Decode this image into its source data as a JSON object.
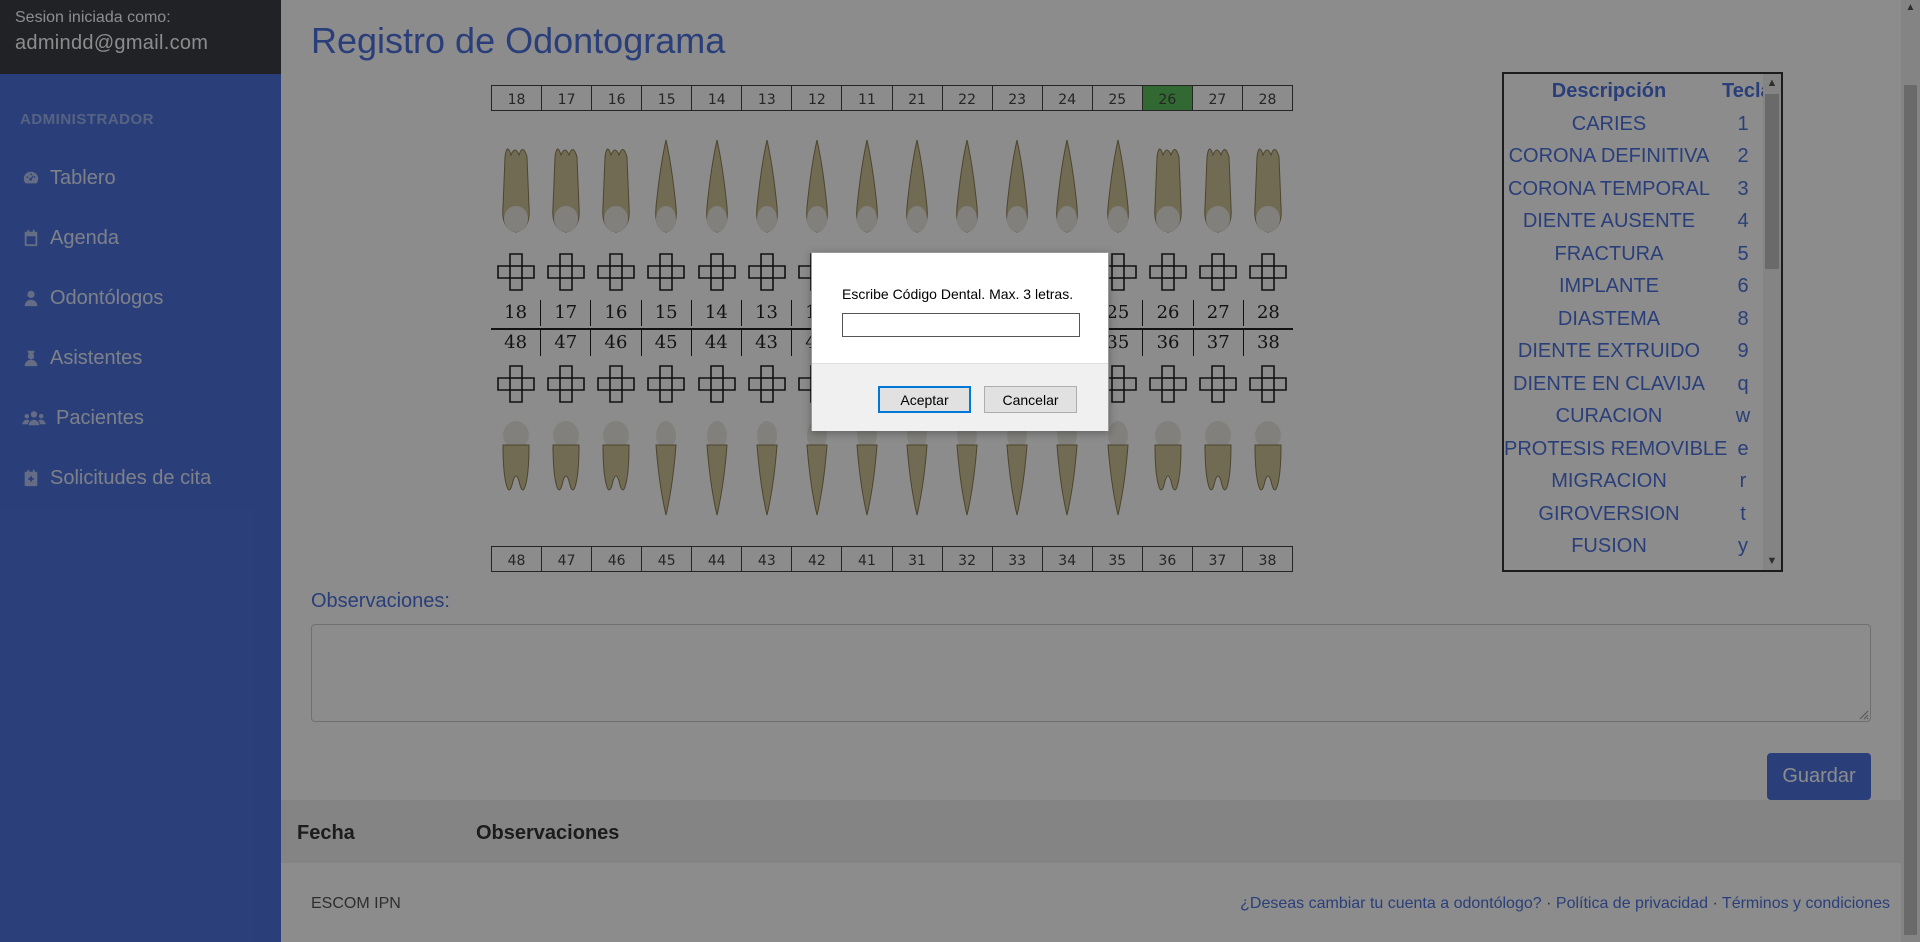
{
  "session": {
    "label": "Sesion iniciada como:",
    "email": "admindd@gmail.com"
  },
  "sidebar": {
    "role": "ADMINISTRADOR",
    "items": [
      {
        "label": "Tablero",
        "icon": "tachometer-icon"
      },
      {
        "label": "Agenda",
        "icon": "calendar-icon"
      },
      {
        "label": "Odontólogos",
        "icon": "user-md-icon"
      },
      {
        "label": "Asistentes",
        "icon": "user-nurse-icon"
      },
      {
        "label": "Pacientes",
        "icon": "users-icon"
      },
      {
        "label": "Solicitudes de cita",
        "icon": "calendar-plus-icon"
      }
    ]
  },
  "page": {
    "title": "Registro de Odontograma"
  },
  "odontograma": {
    "upper_numbers": [
      "18",
      "17",
      "16",
      "15",
      "14",
      "13",
      "12",
      "11",
      "21",
      "22",
      "23",
      "24",
      "25",
      "26",
      "27",
      "28"
    ],
    "lower_numbers": [
      "48",
      "47",
      "46",
      "45",
      "44",
      "43",
      "42",
      "41",
      "31",
      "32",
      "33",
      "34",
      "35",
      "36",
      "37",
      "38"
    ],
    "selected_tooth": "26",
    "highlight_color": "#5cbf5c"
  },
  "descripcion": {
    "header_desc": "Descripción",
    "header_key": "Tecla",
    "rows": [
      {
        "desc": "CARIES",
        "key": "1"
      },
      {
        "desc": "CORONA DEFINITIVA",
        "key": "2"
      },
      {
        "desc": "CORONA TEMPORAL",
        "key": "3"
      },
      {
        "desc": "DIENTE AUSENTE",
        "key": "4"
      },
      {
        "desc": "FRACTURA",
        "key": "5"
      },
      {
        "desc": "IMPLANTE",
        "key": "6"
      },
      {
        "desc": "DIASTEMA",
        "key": "8"
      },
      {
        "desc": "DIENTE EXTRUIDO",
        "key": "9"
      },
      {
        "desc": "DIENTE EN CLAVIJA",
        "key": "q"
      },
      {
        "desc": "CURACION",
        "key": "w"
      },
      {
        "desc": "PROTESIS REMOVIBLE",
        "key": "e"
      },
      {
        "desc": "MIGRACION",
        "key": "r"
      },
      {
        "desc": "GIROVERSION",
        "key": "t"
      },
      {
        "desc": "FUSION",
        "key": "y"
      }
    ]
  },
  "observaciones": {
    "label": "Observaciones:",
    "value": ""
  },
  "actions": {
    "save_label": "Guardar"
  },
  "history": {
    "col_fecha": "Fecha",
    "col_obs": "Observaciones"
  },
  "footer": {
    "left": "ESCOM IPN",
    "links": [
      "¿Deseas cambiar tu cuenta a odontólogo?",
      "Política de privacidad",
      "Términos y condiciones"
    ],
    "separator": "·"
  },
  "dialog": {
    "message": "Escribe Código Dental. Max. 3 letras.",
    "input_value": "",
    "accept_label": "Aceptar",
    "cancel_label": "Cancelar"
  },
  "colors": {
    "primary": "#4e73df",
    "sidebar_top": "#3b3f45"
  }
}
